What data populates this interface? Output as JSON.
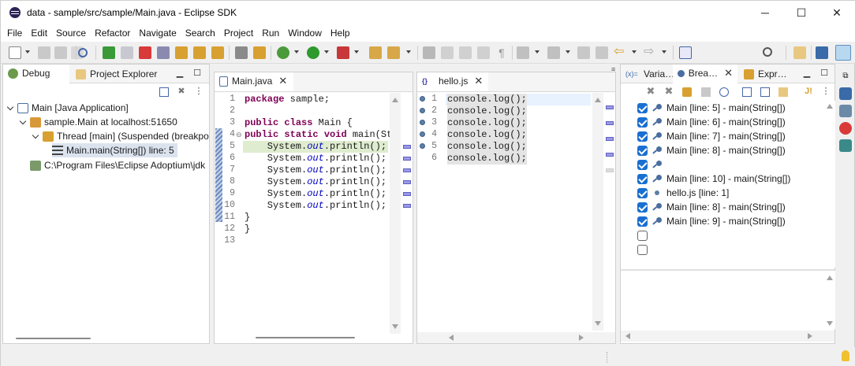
{
  "window": {
    "title": "data - sample/src/sample/Main.java - Eclipse SDK",
    "controls": {
      "minimize": "─",
      "maximize": "☐",
      "close": "✕"
    }
  },
  "menu": [
    "File",
    "Edit",
    "Source",
    "Refactor",
    "Navigate",
    "Search",
    "Project",
    "Run",
    "Window",
    "Help"
  ],
  "debug_view": {
    "tabs": [
      {
        "label": "Debug",
        "icon": "debug-icon",
        "active": true
      },
      {
        "label": "Project Explorer",
        "icon": "project-explorer-icon",
        "active": false
      }
    ],
    "tree": [
      {
        "label": "Main [Java Application]",
        "level": 0,
        "icon": "java-launch-icon"
      },
      {
        "label": "sample.Main at localhost:51650",
        "level": 1,
        "icon": "debug-target-icon"
      },
      {
        "label": "Thread [main] (Suspended (breakpo",
        "level": 2,
        "icon": "thread-icon"
      },
      {
        "label": "Main.main(String[]) line: 5",
        "level": 3,
        "icon": "stack-frame-icon",
        "selected": true
      },
      {
        "label": "C:\\Program Files\\Eclipse Adoptium\\jdk",
        "level": 1,
        "icon": "process-icon"
      }
    ]
  },
  "editor_main": {
    "tab": {
      "label": "Main.java",
      "icon": "java-file-icon"
    },
    "line_numbers": [
      "1",
      "2",
      "3",
      "4",
      "5",
      "6",
      "7",
      "8",
      "9",
      "10",
      "11",
      "12",
      "13"
    ],
    "current_line": 5,
    "code": {
      "l1a": "package",
      "l1b": " sample;",
      "l3a": "public",
      "l3b": " ",
      "l3c": "class",
      "l3d": " Main {",
      "l4a": "public",
      "l4b": " ",
      "l4c": "static",
      "l4d": " ",
      "l4e": "void",
      "l4f": " main(St",
      "pre": "    System.",
      "out": "out",
      "post": ".println();",
      "l11": "}",
      "l12": "}"
    }
  },
  "editor_js": {
    "tab": {
      "label": "hello.js",
      "icon": "js-file-icon"
    },
    "line_numbers": [
      "1",
      "2",
      "3",
      "4",
      "5",
      "6"
    ],
    "lines": [
      "console.log();",
      "console.log();",
      "console.log();",
      "console.log();",
      "console.log();",
      "console.log();"
    ]
  },
  "right_panel": {
    "tabs": [
      {
        "label": "Varia…",
        "icon": "variables-icon"
      },
      {
        "label": "Brea…",
        "icon": "breakpoints-icon",
        "active": true
      },
      {
        "label": "Expr…",
        "icon": "expressions-icon"
      }
    ],
    "breakpoints": [
      {
        "checked": true,
        "label": "Main [line: 5] - main(String[])",
        "icon": "breakpoint-icon"
      },
      {
        "checked": true,
        "label": "Main [line: 6] - main(String[])",
        "icon": "breakpoint-icon"
      },
      {
        "checked": true,
        "label": "Main [line: 7] - main(String[])",
        "icon": "breakpoint-icon"
      },
      {
        "checked": true,
        "label": "Main [line: 8] - main(String[])",
        "icon": "breakpoint-icon"
      },
      {
        "checked": true,
        "label": "",
        "icon": "breakpoint-icon"
      },
      {
        "checked": true,
        "label": "Main [line: 10] - main(String[])",
        "icon": "breakpoint-icon"
      },
      {
        "checked": true,
        "label": "hello.js [line: 1]",
        "icon": "js-breakpoint-icon"
      },
      {
        "checked": true,
        "label": "Main [line: 8] - main(String[])",
        "icon": "breakpoint-icon"
      },
      {
        "checked": true,
        "label": "Main [line: 9] - main(String[])",
        "icon": "breakpoint-icon"
      },
      {
        "checked": false,
        "label": "",
        "icon": ""
      },
      {
        "checked": false,
        "label": "",
        "icon": ""
      }
    ]
  },
  "colors": {
    "keyword": "#7f0055",
    "field": "#0000c0",
    "current_line_highlight": "#dfeccf",
    "selection": "#dbe3ef",
    "checkbox": "#1a6fd1"
  }
}
